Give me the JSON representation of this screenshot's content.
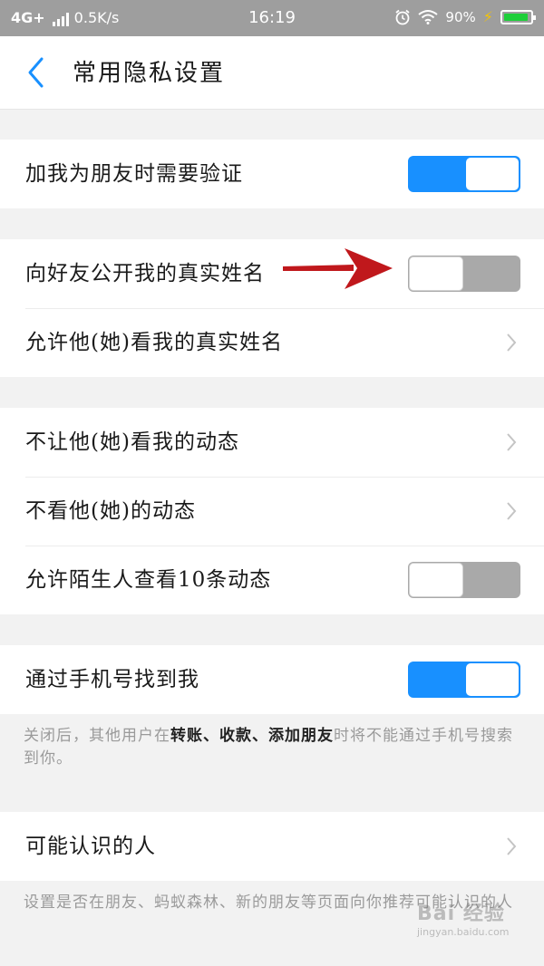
{
  "status_bar": {
    "network": "4G+",
    "speed": "0.5K/s",
    "time": "16:19",
    "alarm_icon": "alarm-icon",
    "wifi_icon": "wifi-icon",
    "battery_percent": "90%",
    "battery_level": 0.9,
    "charging_icon": "charging-bolt-icon"
  },
  "header": {
    "back_icon": "back-chevron-icon",
    "title": "常用隐私设置"
  },
  "settings": {
    "verify_friend": {
      "label": "加我为朋友时需要验证",
      "enabled": true
    },
    "show_real_name": {
      "label": "向好友公开我的真实姓名",
      "enabled": false
    },
    "allow_view_real_name": {
      "label": "允许他(她)看我的真实姓名"
    },
    "hide_my_moments": {
      "label": "不让他(她)看我的动态"
    },
    "hide_their_moments": {
      "label": "不看他(她)的动态"
    },
    "stranger_view_10": {
      "label": "允许陌生人查看10条动态",
      "enabled": false
    },
    "find_by_phone": {
      "label": "通过手机号找到我",
      "enabled": true
    },
    "phone_note": {
      "part1": "关闭后，其他用户在",
      "bold1": "转账、收款、添加朋友",
      "part2": "时将不能通过手机号搜索到你。"
    },
    "people_you_may_know": {
      "label": "可能认识的人"
    },
    "pymk_note": "设置是否在朋友、蚂蚁森林、新的朋友等页面向你推荐可能认识的人"
  },
  "watermark": {
    "main": "Bai 经验",
    "sub": "jingyan.baidu.com"
  },
  "colors": {
    "accent": "#1890ff",
    "toggle_off": "#a9a9a9",
    "arrow": "#c0181c",
    "status_bar": "#9e9e9e"
  }
}
